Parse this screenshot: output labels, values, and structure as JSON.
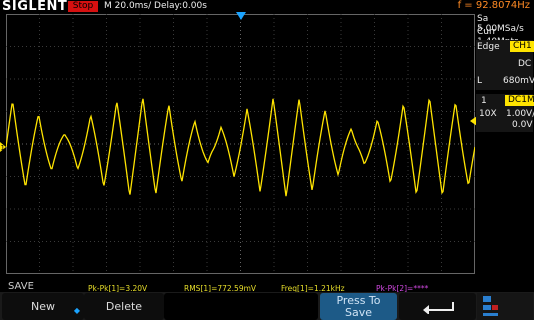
{
  "header": {
    "brand": "SIGLENT",
    "run_state": "Stop",
    "timebase": "M 20.0ms/ Delay:0.00s",
    "frequency": "f = 92.8074Hz"
  },
  "acquisition": {
    "sample_rate": "Sa 5.00MSa/s",
    "memory": "Curr 1.40Mpts"
  },
  "trigger": {
    "type": "Edge",
    "source": "CH1",
    "coupling": "DC",
    "level_prefix": "L",
    "level": "680mV"
  },
  "channel1": {
    "number": "1",
    "coupling": "DC1M",
    "probe": "10X",
    "scale": "1.00V/",
    "offset": "0.0V"
  },
  "status": {
    "save_label": "SAVE",
    "pkpk1": "Pk-Pk[1]=3.20V",
    "rms1": "RMS[1]=772.59mV",
    "freq1": "Freq[1]=1.21kHz",
    "pkpk2": "Pk-Pk[2]=****"
  },
  "softkeys": {
    "new": "New",
    "delete": "Delete",
    "press_to_save_line1": "Press To",
    "press_to_save_line2": "Save"
  },
  "colors": {
    "ch1": "#ffe400",
    "stop": "#d61010",
    "frequency": "#ff8a24",
    "trigger_marker": "#1aa3ff",
    "softkey_active": "#1d5a87"
  }
}
